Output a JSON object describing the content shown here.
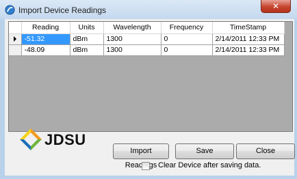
{
  "window": {
    "title": "Import Device Readings",
    "close_glyph": "✕"
  },
  "grid": {
    "columns": [
      "Reading",
      "Units",
      "Wavelength",
      "Frequency",
      "TimeStamp"
    ],
    "rows": [
      [
        "-51.32",
        "dBm",
        "1300",
        "0",
        "2/14/2011 12:33 PM"
      ],
      [
        "-48.09",
        "dBm",
        "1300",
        "0",
        "2/14/2011 12:33 PM"
      ]
    ]
  },
  "logo": {
    "text": "JDSU"
  },
  "buttons": {
    "import": "Import Readings",
    "save": "Save",
    "close": "Close"
  },
  "options": {
    "clear_device_label": "Clear Device after saving data.",
    "clear_device_checked": false
  },
  "colors": {
    "selection": "#3399ff",
    "logo_blue": "#1d6fb8",
    "logo_orange": "#f39a1f",
    "logo_yellow": "#f7d31a",
    "logo_green": "#6fb43f"
  }
}
